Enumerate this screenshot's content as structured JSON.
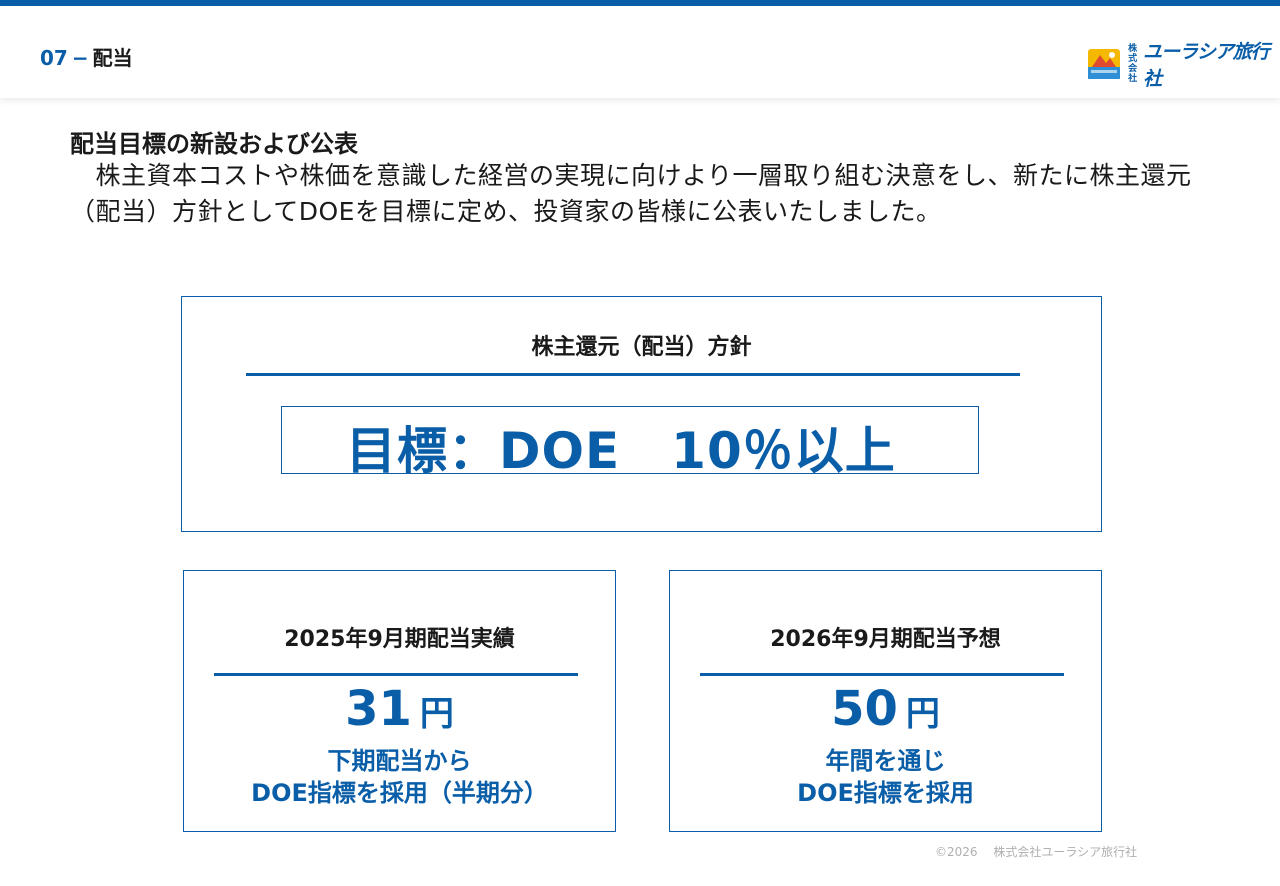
{
  "header": {
    "section_number": "07",
    "section_dash": "−",
    "section_title": "配当",
    "logo": {
      "small_text": "株式会社",
      "text": "ユーラシア旅行社"
    }
  },
  "main": {
    "heading": "配当目標の新設および公表",
    "body": "　株主資本コストや株価を意識した経営の実現に向けより一層取り組む決意をし、新たに株主還元（配当）方針としてDOEを目標に定め、投資家の皆様に公表いたしました。"
  },
  "policy": {
    "title": "株主還元（配当）方針",
    "target": "目標：DOE　10％以上"
  },
  "cards": [
    {
      "title": "2025年9月期配当実績",
      "value": "31",
      "unit": "円",
      "note_line1": "下期配当から",
      "note_line2": "DOE指標を採用（半期分）"
    },
    {
      "title": "2026年9月期配当予想",
      "value": "50",
      "unit": "円",
      "note_line1": "年間を通じ",
      "note_line2": "DOE指標を採用"
    }
  ],
  "footer": {
    "copyright": "©2026　 株式会社ユーラシア旅行社"
  },
  "colors": {
    "accent": "#0a5ea8",
    "text": "#1a1a1a",
    "footer": "#b0b0b0"
  }
}
